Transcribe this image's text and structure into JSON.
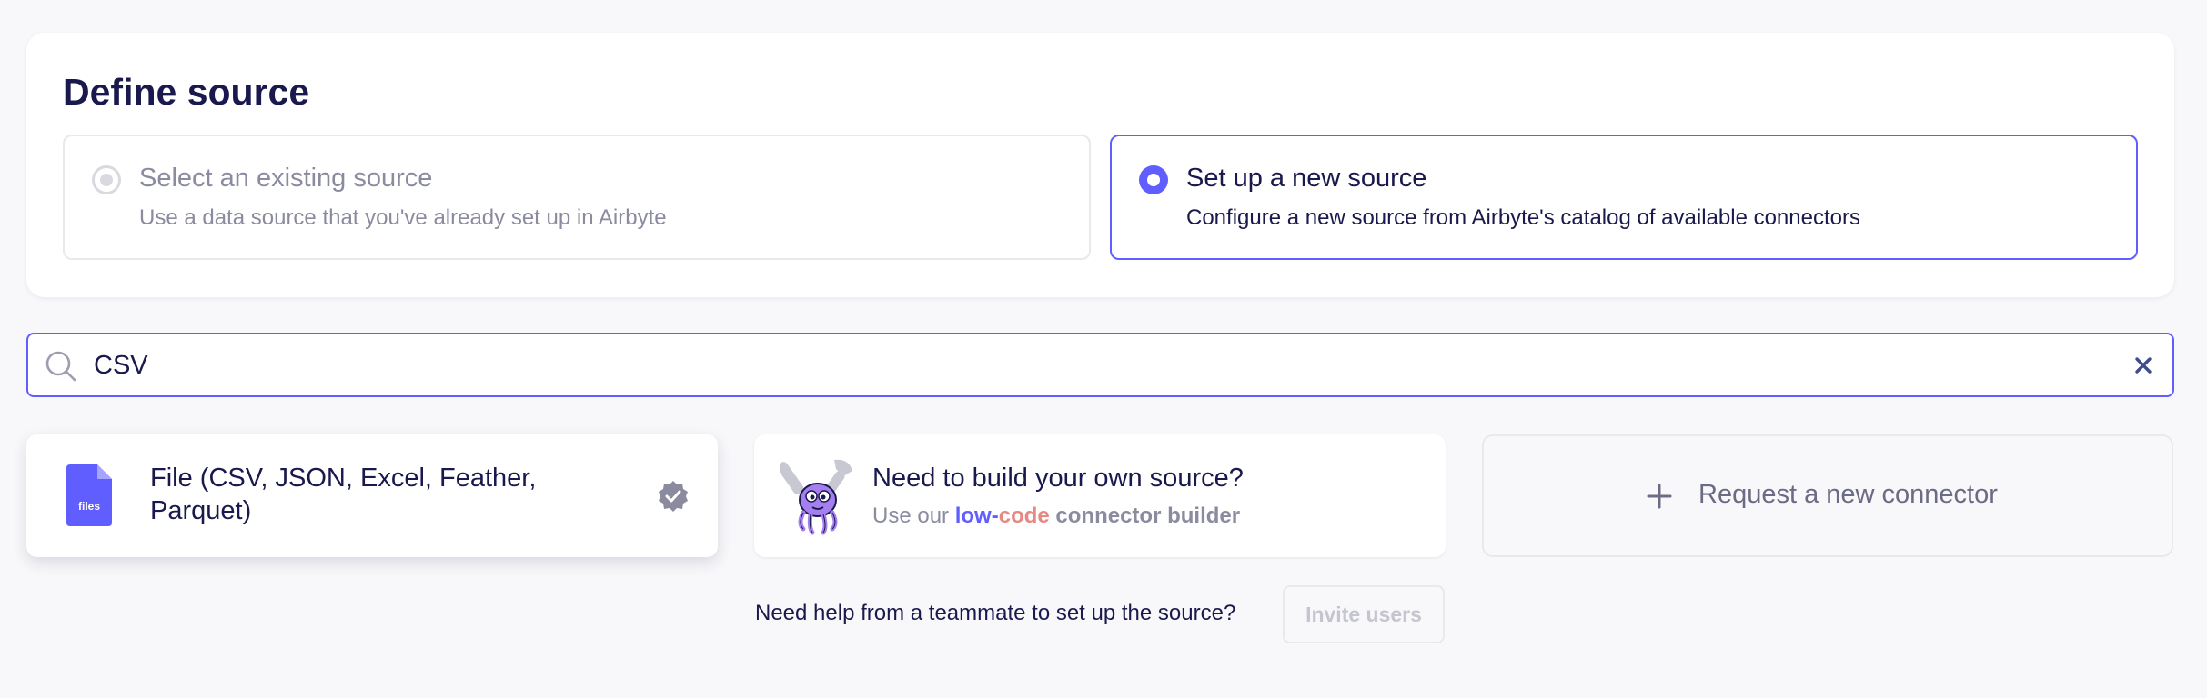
{
  "define": {
    "title": "Define source",
    "existing": {
      "title": "Select an existing source",
      "description": "Use a data source that you've already set up in Airbyte",
      "selected": false
    },
    "new": {
      "title": "Set up a new source",
      "description": "Configure a new source from Airbyte's catalog of available connectors",
      "selected": true
    }
  },
  "search": {
    "icon": "search-icon",
    "value": "CSV",
    "clear_icon": "close-icon"
  },
  "connectors": {
    "file": {
      "name": "File (CSV, JSON, Excel, Feather, Parquet)",
      "icon": "file-icon",
      "icon_label": "files",
      "badge": "certified-check-icon"
    },
    "builder": {
      "title": "Need to build your own source?",
      "subtitle_prefix": "Use our",
      "subtitle_low": "low-",
      "subtitle_code": "code",
      "subtitle_suffix": "connector builder"
    },
    "request": {
      "label": "Request a new connector"
    }
  },
  "help": {
    "text": "Need help from a teammate to set up the source?",
    "button": "Invite users"
  },
  "colors": {
    "accent": "#615eff",
    "text": "#1a194d",
    "muted": "#8b8ba0",
    "code_pink": "#e58982"
  }
}
